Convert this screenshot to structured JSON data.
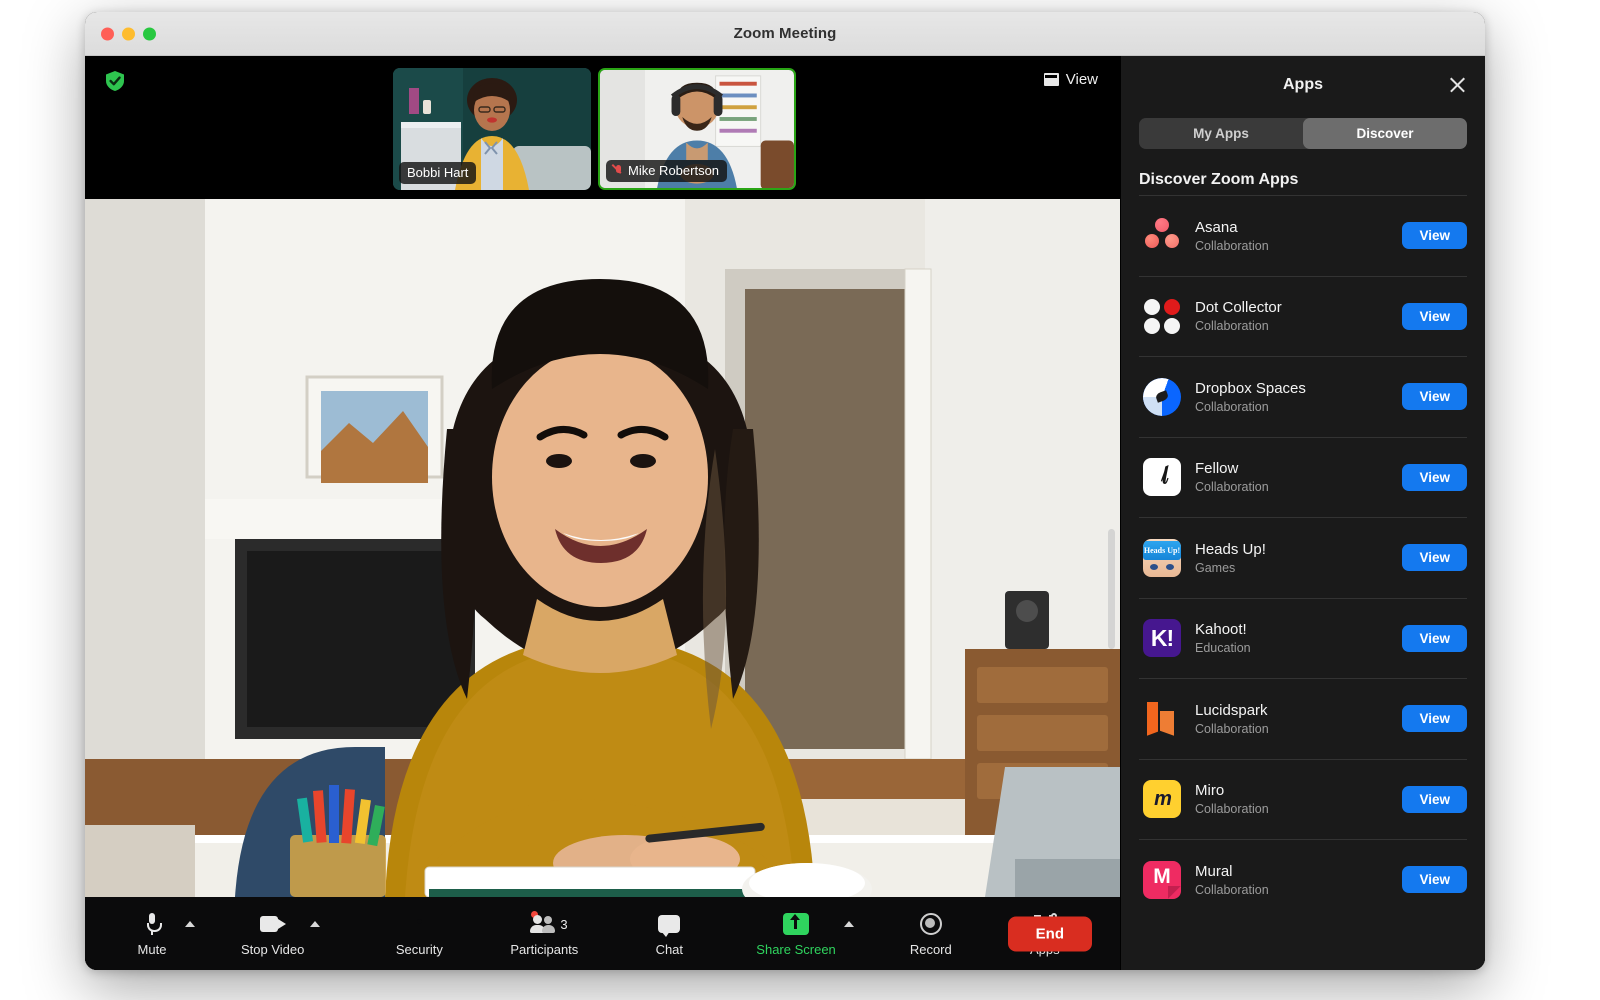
{
  "window": {
    "title": "Zoom Meeting",
    "traffic_lights": [
      "close",
      "minimize",
      "maximize"
    ]
  },
  "video": {
    "secure_badge": "encryption-shield-icon",
    "view_button_label": "View",
    "thumbnails": [
      {
        "name": "Bobbi Hart",
        "muted": false,
        "active_speaker": false
      },
      {
        "name": "Mike Robertson",
        "muted": true,
        "active_speaker": true
      }
    ]
  },
  "toolbar": {
    "controls": [
      {
        "label": "Mute",
        "icon": "microphone-icon",
        "caret": true,
        "accent": ""
      },
      {
        "label": "Stop Video",
        "icon": "camera-icon",
        "caret": true,
        "accent": ""
      },
      {
        "label": "Security",
        "icon": "shield-icon",
        "caret": false,
        "accent": ""
      },
      {
        "label": "Participants",
        "icon": "participants-icon",
        "caret": false,
        "accent": "",
        "badge": "3",
        "alert_dot": true
      },
      {
        "label": "Chat",
        "icon": "chat-bubble-icon",
        "caret": false,
        "accent": ""
      },
      {
        "label": "Share Screen",
        "icon": "share-screen-icon",
        "caret": true,
        "accent": "#2fd45e"
      },
      {
        "label": "Record",
        "icon": "record-icon",
        "caret": false,
        "accent": ""
      },
      {
        "label": "Apps",
        "icon": "apps-icon",
        "caret": false,
        "accent": ""
      }
    ],
    "end_label": "End",
    "end_color": "#d92d20"
  },
  "panel": {
    "title": "Apps",
    "close_icon": "close-icon",
    "tabs": [
      {
        "label": "My Apps",
        "active": false
      },
      {
        "label": "Discover",
        "active": true
      }
    ],
    "section_heading": "Discover Zoom Apps",
    "view_label": "View",
    "accent_blue": "#1479ef",
    "apps": [
      {
        "name": "Asana",
        "category": "Collaboration",
        "icon": "asana-icon",
        "action": "View"
      },
      {
        "name": "Dot Collector",
        "category": "Collaboration",
        "icon": "dot-collector-icon",
        "action": "View"
      },
      {
        "name": "Dropbox Spaces",
        "category": "Collaboration",
        "icon": "dropbox-spaces-icon",
        "action": "View"
      },
      {
        "name": "Fellow",
        "category": "Collaboration",
        "icon": "fellow-icon",
        "action": "View"
      },
      {
        "name": "Heads Up!",
        "category": "Games",
        "icon": "heads-up-icon",
        "action": "View"
      },
      {
        "name": "Kahoot!",
        "category": "Education",
        "icon": "kahoot-icon",
        "action": "View"
      },
      {
        "name": "Lucidspark",
        "category": "Collaboration",
        "icon": "lucidspark-icon",
        "action": "View"
      },
      {
        "name": "Miro",
        "category": "Collaboration",
        "icon": "miro-icon",
        "action": "View"
      },
      {
        "name": "Mural",
        "category": "Collaboration",
        "icon": "mural-icon",
        "action": "View"
      }
    ]
  }
}
